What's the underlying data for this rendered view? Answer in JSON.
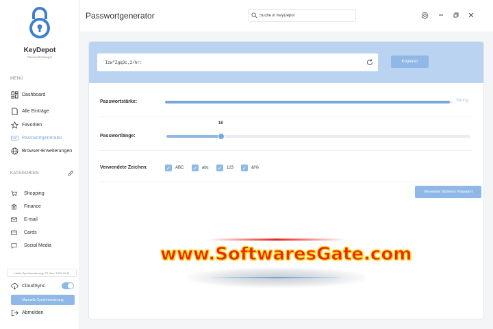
{
  "app": {
    "brand": "KeyDepot",
    "brand_sub": "Passwortmanager"
  },
  "sidebar": {
    "menu_label": "MENÜ",
    "items": [
      {
        "label": "Dashboard",
        "icon": "dashboard-icon"
      },
      {
        "label": "Alle Einträge",
        "icon": "document-icon"
      },
      {
        "label": "Favoriten",
        "icon": "star-icon"
      },
      {
        "label": "Passwortgenerator",
        "icon": "keyboard-icon",
        "active": true
      },
      {
        "label": "Browser-Erweiterungen",
        "icon": "globe-icon"
      }
    ],
    "categories_label": "KATEGORIEN",
    "categories": [
      {
        "label": "Shopping",
        "icon": "cart-icon"
      },
      {
        "label": "Finance",
        "icon": "bank-icon"
      },
      {
        "label": "E-mail",
        "icon": "mail-icon"
      },
      {
        "label": "Cards",
        "icon": "card-icon"
      },
      {
        "label": "Social Media",
        "icon": "chat-icon"
      }
    ],
    "last_sync": "Letzte Synchronisierung: 22. Nov. 2023 13:44",
    "cloudsync_label": "CloudSync",
    "manual_sync_label": "Manuelle Synchronisierung",
    "logout_label": "Abmelden"
  },
  "header": {
    "title": "Passwortgenerator",
    "search_placeholder": "Suche in KeyDepot"
  },
  "generator": {
    "password": "`Izw\"Zgq3c,2/hr:",
    "copy_label": "Kopieren",
    "strength_label": "Passwortstärke:",
    "strength_text": "Strong",
    "strength_level": 0.99,
    "length_label": "Passwortlänge:",
    "length_value": "16",
    "length_fraction": 0.18,
    "chars_label": "Verwendete Zeichen:",
    "charsets": [
      {
        "label": "ABC",
        "checked": true
      },
      {
        "label": "abc",
        "checked": true
      },
      {
        "label": "123",
        "checked": true
      },
      {
        "label": "&!%",
        "checked": true
      }
    ],
    "secure_label": "Verwende Sicheres Passwort"
  },
  "watermark": {
    "text": "www.SoftwaresGate.com"
  },
  "colors": {
    "accent": "#8fb8e6",
    "accent_dark": "#7aa7da",
    "header_band": "#b9d3f1"
  }
}
